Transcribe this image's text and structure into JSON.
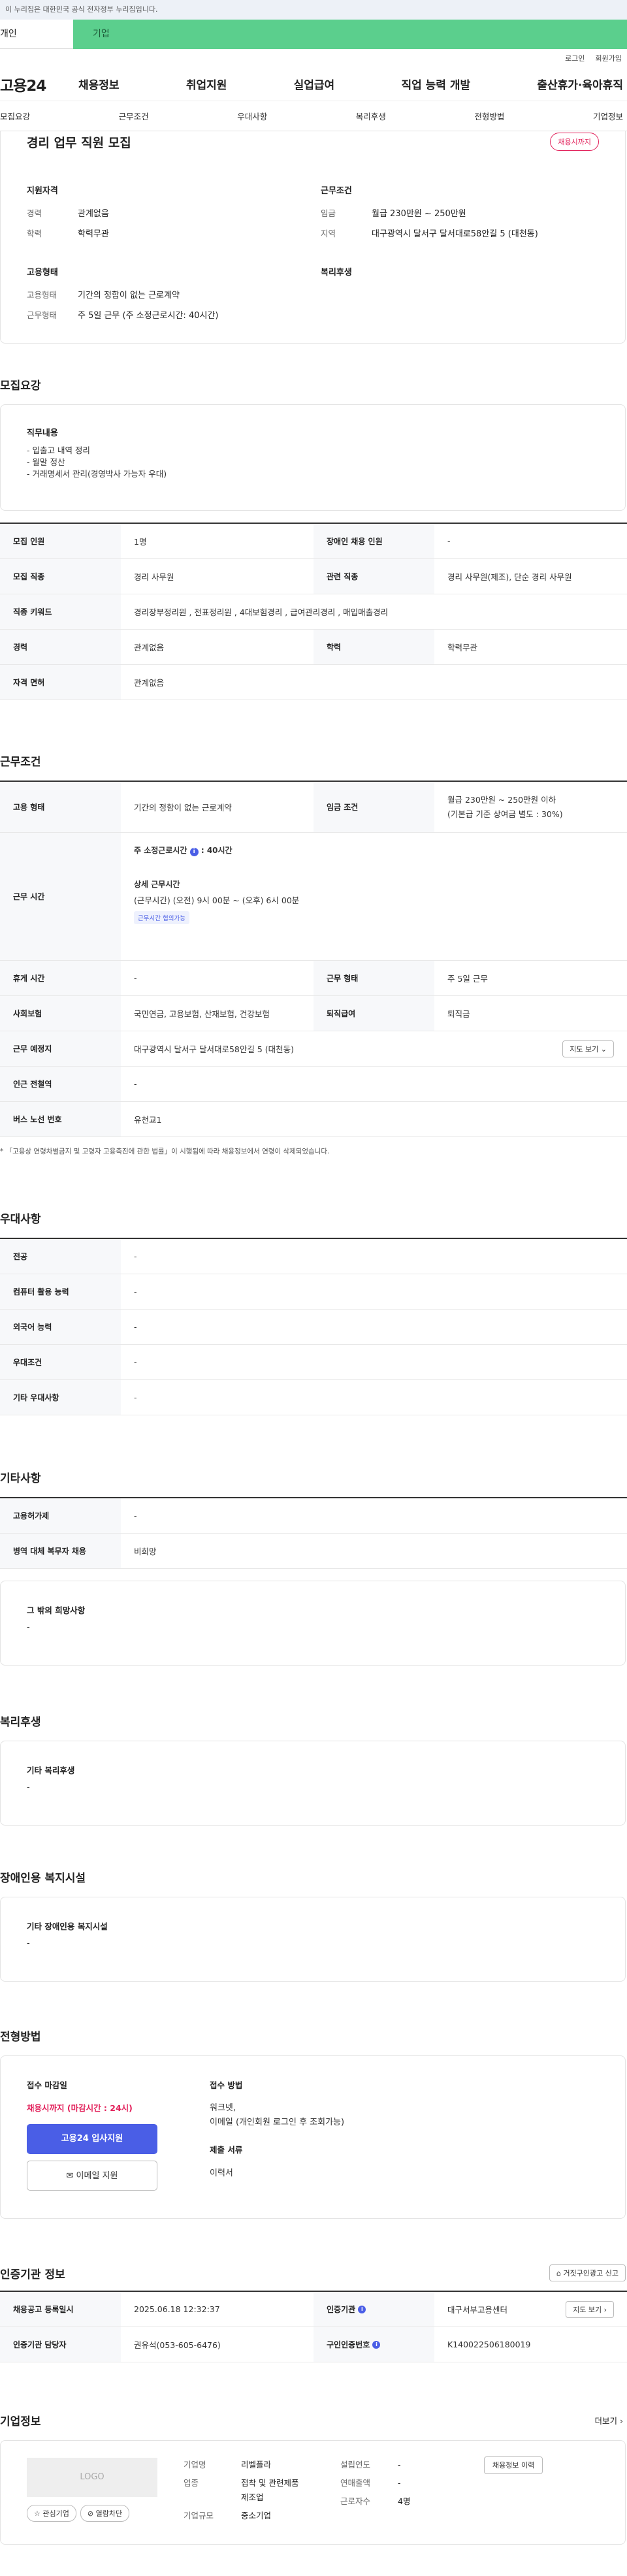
{
  "gov": "이 누리집은 대한민국 공식 전자정부 누리집입니다.",
  "role": {
    "personal": "개인",
    "company": "기업"
  },
  "util": {
    "login": "로그인",
    "signup": "회원가입"
  },
  "gnb": {
    "logo": "고용24",
    "menu": [
      "채용정보",
      "취업지원",
      "실업급여",
      "직업 능력 개발",
      "출산휴가·육아휴직"
    ]
  },
  "snb": [
    "모집요강",
    "근무조건",
    "우대사항",
    "복리후생",
    "전형방법",
    "기업정보"
  ],
  "summary": {
    "title": "경리 업무 직원 모집",
    "status": "채용시까지",
    "qual_h": "지원자격",
    "work_h": "근무조건",
    "career_k": "경력",
    "career_v": "관계없음",
    "edu_k": "학력",
    "edu_v": "학력무관",
    "wage_k": "임금",
    "wage_v": "월급 230만원 ~ 250만원",
    "area_k": "지역",
    "area_v": "대구광역시 달서구 달서대로58안길 5 (대천동)",
    "emp_h": "고용형태",
    "welfare_h": "복리후생",
    "type_k": "고용형태",
    "type_v": "기간의 정함이 없는 근로계약",
    "hours_k": "근무형태",
    "hours_v": "주 5일 근무 (주 소정근로시간: 40시간)"
  },
  "recruit": {
    "title": "모집요강",
    "job_h": "직무내용",
    "duties": [
      "- 입출고 내역 정리",
      "- 월말 정산",
      "- 거래명세서 관리(경영박사 가능자 우대)"
    ],
    "rows": [
      [
        "모집 인원",
        "1명",
        "장애인 채용 인원",
        "-"
      ],
      [
        "모집 직종",
        "경리 사무원",
        "관련 직종",
        "경리 사무원(제조), 단순 경리 사무원"
      ],
      [
        "직종 키워드",
        "경리장부정리원 , 전표정리원 , 4대보험경리 , 급여관리경리 , 매입매출경리"
      ],
      [
        "경력",
        "관계없음",
        "학력",
        "학력무관"
      ],
      [
        "자격 면허",
        "관계없음"
      ]
    ]
  },
  "cond": {
    "title": "근무조건",
    "type_k": "고용 형태",
    "type_v": "기간의 정함이 없는 근로계약",
    "wage_k": "임금 조건",
    "wage_v1": "월급 230만원 ~ 250만원 이하",
    "wage_v2": "(기본급 기준 상여금 별도 : 30%)",
    "time_k": "근무 시간",
    "time_main": "주 소정근로시간",
    "time_hours": "40시간",
    "detail_h": "상세 근무시간",
    "detail_v": "(근무시간) (오전) 9시 00분 ~ (오후) 6시 00분",
    "tag": "근무시간 협의가능",
    "rest_k": "휴게 시간",
    "rest_v": "-",
    "shift_k": "근무 형태",
    "shift_v": "주 5일 근무",
    "ins_k": "사회보험",
    "ins_v": "국민연금, 고용보험, 산재보험, 건강보험",
    "sev_k": "퇴직급여",
    "sev_v": "퇴직금",
    "loc_k": "근무 예정지",
    "loc_v": "대구광역시 달서구 달서대로58안길 5 (대천동)",
    "map_btn": "지도 보기",
    "sub_k": "인근 전철역",
    "sub_v": "-",
    "bus_k": "버스 노선 번호",
    "bus_v": "유천교1",
    "note": "* 「고용상 연령차별금지 및 고령자 고용촉진에 관한 법률」이 시행됨에 따라 채용정보에서 연령이 삭제되었습니다."
  },
  "pref": {
    "title": "우대사항",
    "rows": [
      [
        "전공",
        "-"
      ],
      [
        "컴퓨터 활용 능력",
        "-"
      ],
      [
        "외국어 능력",
        "-"
      ],
      [
        "우대조건",
        "-"
      ],
      [
        "기타 우대사항",
        "-"
      ]
    ]
  },
  "etc": {
    "title": "기타사항",
    "rows": [
      [
        "고용허가제",
        "-"
      ],
      [
        "병역 대체 복무자 채용",
        "비희망"
      ]
    ],
    "hope_h": "그 밖의 희망사항",
    "hope_v": "-"
  },
  "welfare": {
    "title": "복리후생",
    "h": "기타 복리후생",
    "v": "-"
  },
  "disab": {
    "title": "장애인용 복지시설",
    "h": "기타 장애인용 복지시설",
    "v": "-"
  },
  "proc": {
    "title": "전형방법",
    "deadline_h": "접수 마감일",
    "deadline_v": "채용시까지 (마감시간 : 24시)",
    "apply_btn": "고용24 입사지원",
    "email_btn": "이메일 지원",
    "method_h": "접수 방법",
    "method_v1": "워크넷,",
    "method_v2": "이메일 (개인회원 로그인 후 조회가능)",
    "docs_h": "제출 서류",
    "docs_v": "이력서"
  },
  "cert": {
    "title": "인증기관 정보",
    "report_btn": "거짓구인광고 신고",
    "reg_k": "채용공고 등록일시",
    "reg_v": "2025.06.18 12:32:37",
    "org_k": "인증기관",
    "org_v": "대구서부고용센터",
    "map_btn": "지도 보기",
    "mgr_k": "인증기관 담당자",
    "mgr_v": "권유석(053-605-6476)",
    "no_k": "구인인증번호",
    "no_v": "K140022506180019"
  },
  "company": {
    "title": "기업정보",
    "more": "더보기",
    "logo": "LOGO",
    "fav_btn": "관심기업",
    "block_btn": "열람차단",
    "hist_btn": "채용정보 이력",
    "name_k": "기업명",
    "name_v": "리벨플라",
    "ind_k": "업종",
    "ind_v1": "접착 및 관련제품",
    "ind_v2": "제조업",
    "size_k": "기업규모",
    "size_v": "중소기업",
    "year_k": "설립연도",
    "year_v": "-",
    "sales_k": "연매출액",
    "sales_v": "-",
    "emp_k": "근로자수",
    "emp_v": "4명"
  },
  "colors": {
    "accent": "#e2205a",
    "primary": "#4a5ee6",
    "green": "#5bcf8d"
  }
}
